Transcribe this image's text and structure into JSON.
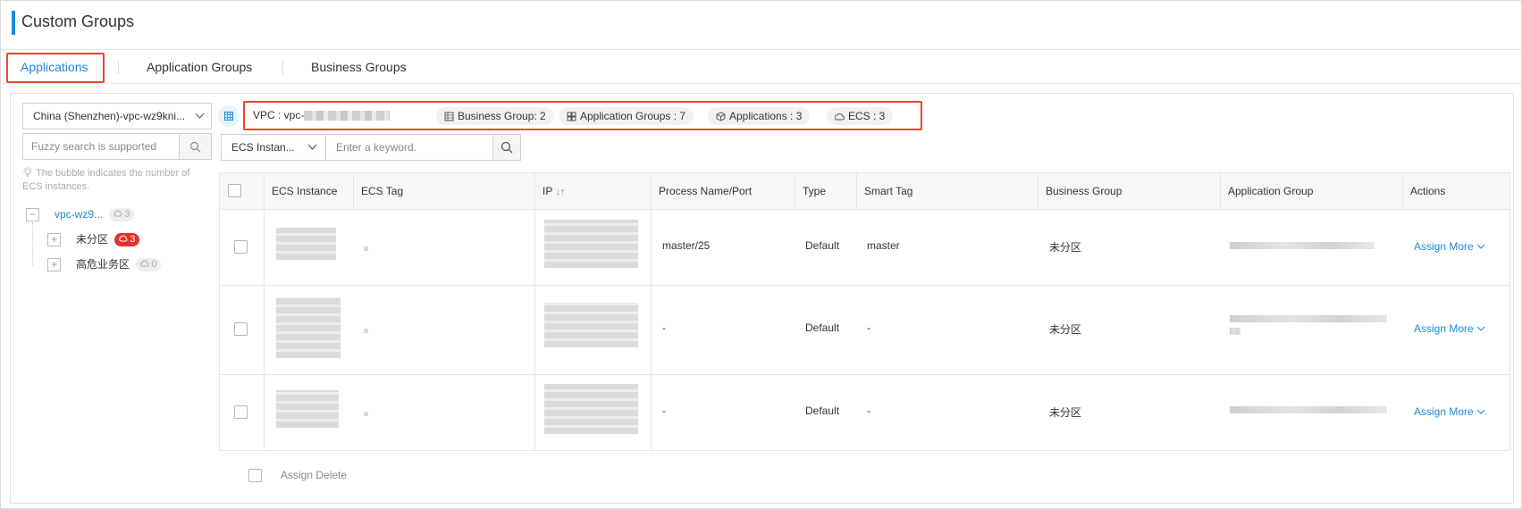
{
  "page": {
    "title": "Custom Groups"
  },
  "tabs": [
    {
      "label": "Applications",
      "active": true
    },
    {
      "label": "Application Groups",
      "active": false
    },
    {
      "label": "Business Groups",
      "active": false
    }
  ],
  "sidebar": {
    "region_select": "China (Shenzhen)-vpc-wz9kni...",
    "search_placeholder": "Fuzzy search is supported",
    "hint": "The bubble indicates the number of ECS instances.",
    "tree": [
      {
        "label": "vpc-wz9...",
        "count": "3",
        "toggle": "−",
        "level": 0
      },
      {
        "label": "未分区",
        "count": "3",
        "toggle": "+",
        "level": 1,
        "highlight": true
      },
      {
        "label": "高危业务区",
        "count": "0",
        "toggle": "+",
        "level": 1
      }
    ]
  },
  "info": {
    "vpc_label": "VPC :  vpc-",
    "business_group": "Business Group: 2",
    "application_groups": "Application Groups : 7",
    "applications": "Applications : 3",
    "ecs": "ECS : 3"
  },
  "filter": {
    "field_select": "ECS Instan...",
    "keyword_placeholder": "Enter a keyword."
  },
  "table": {
    "headers": [
      "ECS Instance",
      "ECS Tag",
      "IP",
      "Process Name/Port",
      "Type",
      "Smart Tag",
      "Business Group",
      "Application Group",
      "Actions"
    ],
    "sort_glyph": "↓↑",
    "rows": [
      {
        "process": "master/25",
        "type": "Default",
        "smart_tag": "master",
        "business_group": "未分区",
        "action_assign": "Assign",
        "action_more": "More"
      },
      {
        "process": "-",
        "type": "Default",
        "smart_tag": "-",
        "business_group": "未分区",
        "action_assign": "Assign",
        "action_more": "More"
      },
      {
        "process": "-",
        "type": "Default",
        "smart_tag": "-",
        "business_group": "未分区",
        "action_assign": "Assign",
        "action_more": "More"
      }
    ]
  },
  "footer": {
    "assign": "Assign",
    "delete": "Delete"
  },
  "colors": {
    "accent": "#1a8ad8",
    "highlight_border": "#e8472d",
    "badge_red": "#e5312a"
  }
}
